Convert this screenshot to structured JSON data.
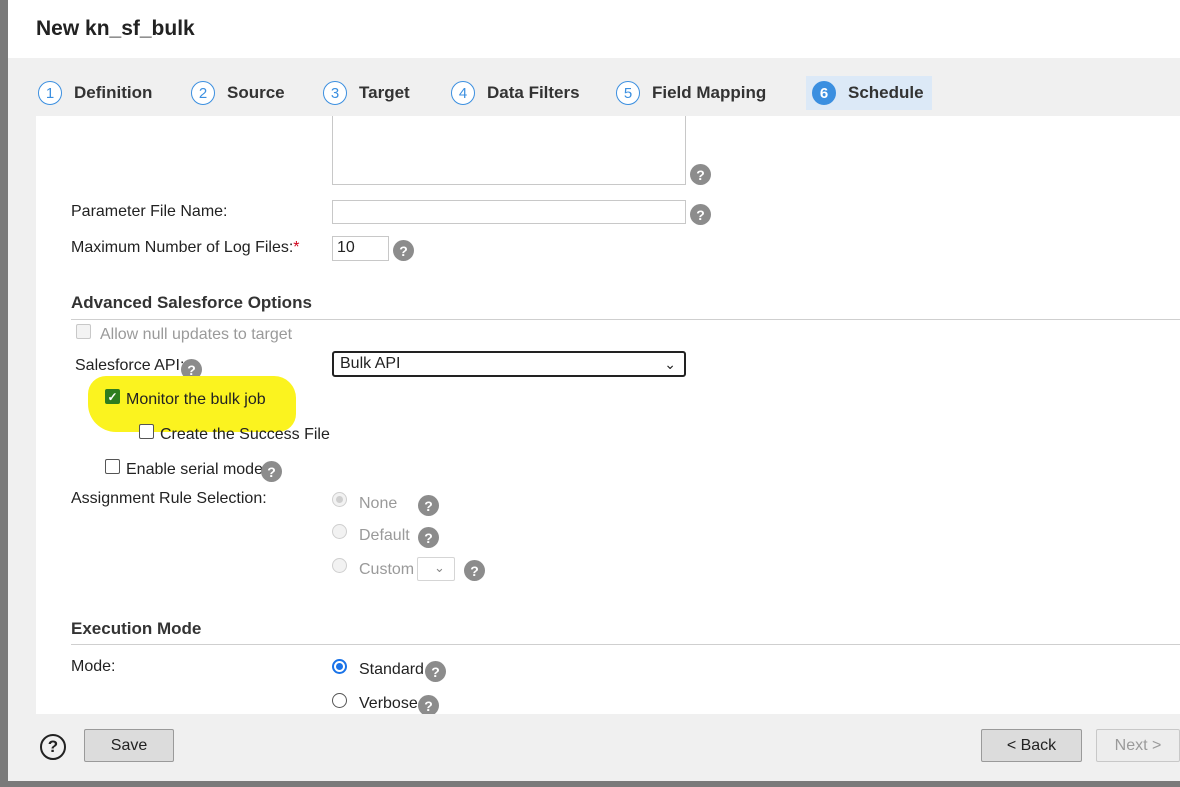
{
  "window": {
    "title": "New kn_sf_bulk"
  },
  "steps": [
    {
      "num": "1",
      "label": "Definition"
    },
    {
      "num": "2",
      "label": "Source"
    },
    {
      "num": "3",
      "label": "Target"
    },
    {
      "num": "4",
      "label": "Data Filters"
    },
    {
      "num": "5",
      "label": "Field Mapping"
    },
    {
      "num": "6",
      "label": "Schedule"
    }
  ],
  "form": {
    "param_file_label": "Parameter File Name:",
    "param_file_value": "",
    "max_logs_label": "Maximum Number of Log Files:",
    "max_logs_required": "*",
    "max_logs_value": "10"
  },
  "advanced": {
    "title": "Advanced Salesforce Options",
    "allow_null_label": "Allow null updates to target",
    "api_label": "Salesforce API:",
    "api_value": "Bulk API",
    "monitor_label": "Monitor the bulk job",
    "success_file_label": "Create the Success File",
    "serial_label": "Enable serial mode",
    "assignment_label": "Assignment Rule Selection:",
    "opt_none": "None",
    "opt_default": "Default",
    "opt_custom": "Custom"
  },
  "execution": {
    "title": "Execution Mode",
    "mode_label": "Mode:",
    "opt_standard": "Standard",
    "opt_verbose": "Verbose"
  },
  "footer": {
    "help": "?",
    "save": "Save",
    "back": "< Back",
    "next": "Next >"
  },
  "icons": {
    "help": "?",
    "chevron": "⌄",
    "check": "✓"
  },
  "colors": {
    "accent": "#3b8fe0",
    "highlight": "#fbf31f",
    "checkbox_checked": "#2e7d1e",
    "radio_selected": "#1a73e8"
  }
}
